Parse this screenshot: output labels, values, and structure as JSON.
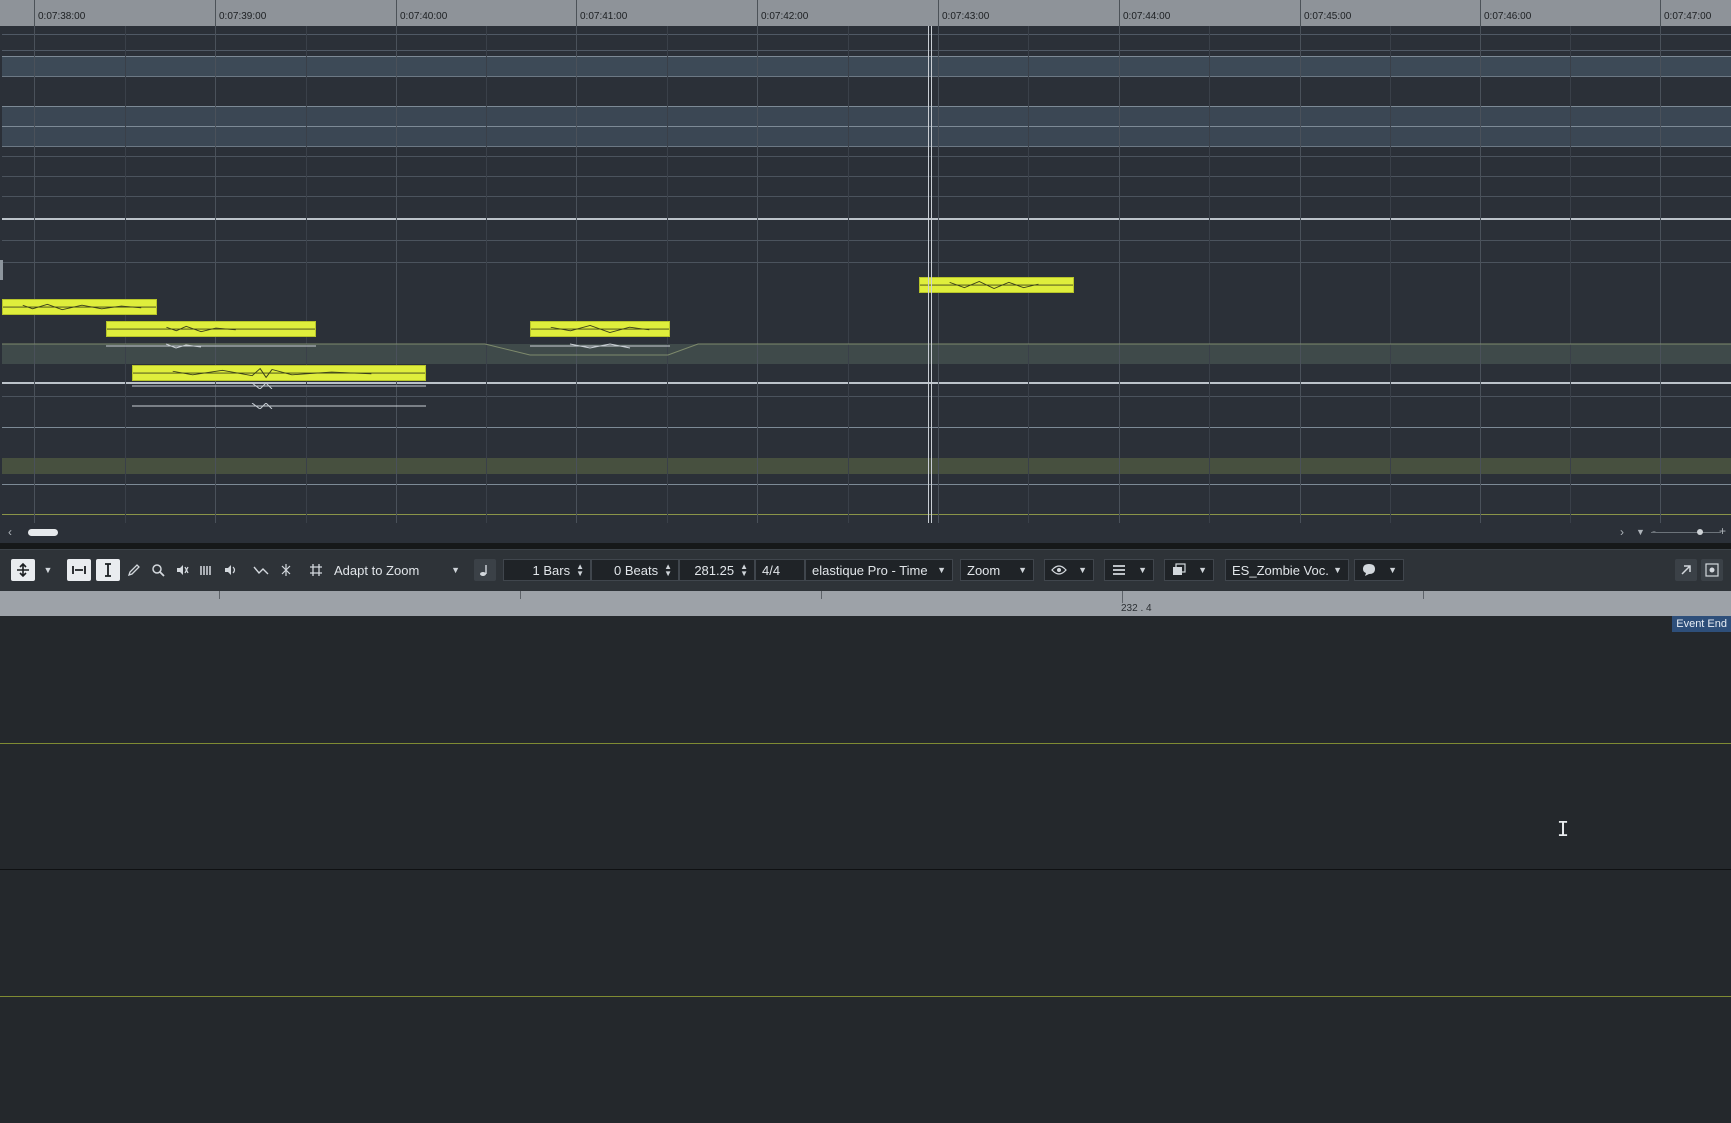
{
  "ruler": {
    "labels": [
      "0:07:38:00",
      "0:07:39:00",
      "0:07:40:00",
      "0:07:41:00",
      "0:07:42:00",
      "0:07:43:00",
      "0:07:44:00",
      "0:07:45:00",
      "0:07:46:00",
      "0:07:47:00"
    ]
  },
  "toolbar": {
    "snap_type": "Adapt to Zoom",
    "length_bars": "1 Bars",
    "length_beats": "0 Beats",
    "tempo": "281.25",
    "signature": "4/4",
    "algorithm": "elastique Pro - Time",
    "zoom_mode": "Zoom",
    "track_name": "ES_Zombie Voc."
  },
  "icons": {
    "object_select": "object-select-icon",
    "range": "range-select-icon",
    "pencil": "pencil-icon",
    "zoom": "zoom-icon",
    "mute": "mute-icon",
    "time_warp": "time-warp-icon",
    "speaker": "speaker-icon",
    "snap": "snap-grid-icon",
    "quantize": "quantize-note-icon",
    "eye": "eye-icon",
    "layers": "layers-icon",
    "window": "window-layout-icon",
    "feedback": "feedback-icon",
    "external": "open-external-icon",
    "settings": "settings-icon"
  },
  "lower_ruler": {
    "label": "232 . 4"
  },
  "lower_panel": {
    "event_end_label": "Event End"
  },
  "colors": {
    "event_fill": "#dfee3c",
    "lane_accent": "#9aa83a",
    "ruler_bg": "#8e9399"
  }
}
